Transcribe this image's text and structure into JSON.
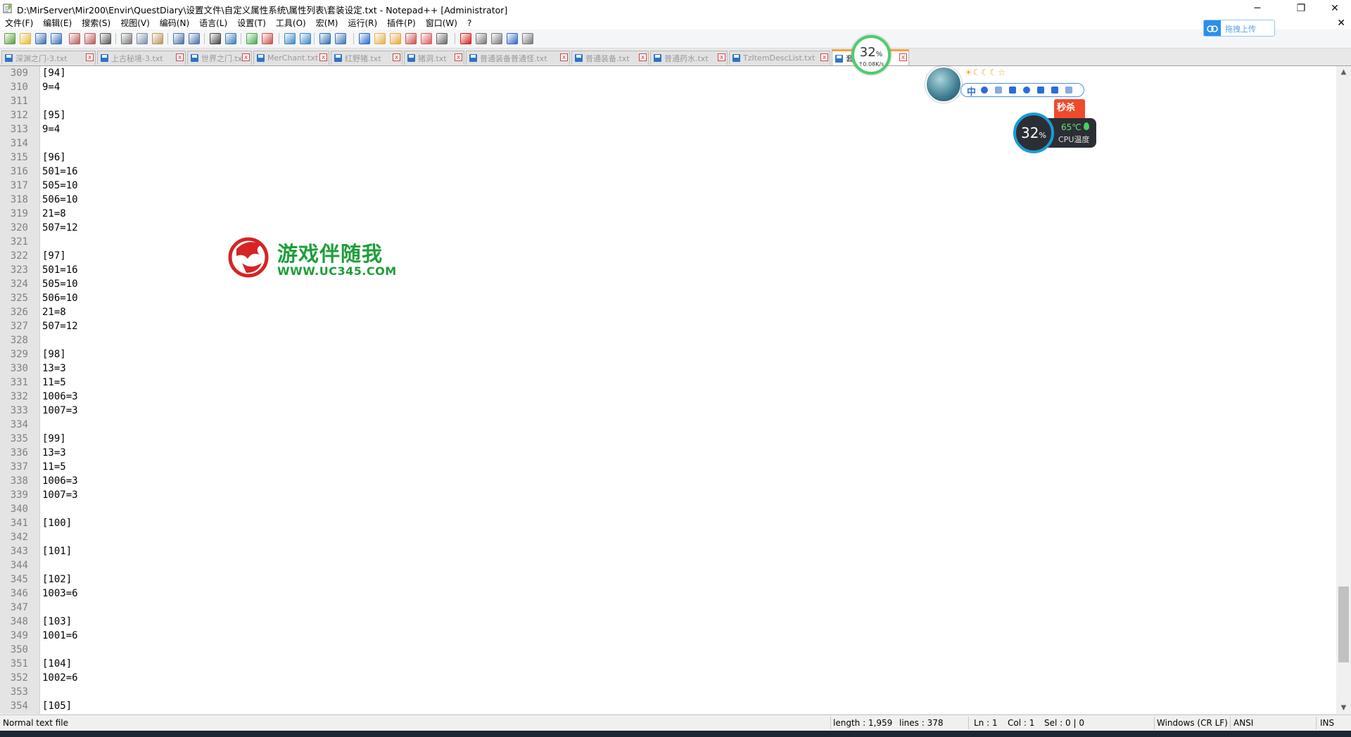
{
  "window": {
    "title": "D:\\MirServer\\Mir200\\Envir\\QuestDiary\\设置文件\\自定义属性系统\\属性列表\\套装设定.txt - Notepad++ [Administrator]",
    "min_glyph": "─",
    "max_glyph": "❐",
    "close_glyph": "✕"
  },
  "menu": [
    {
      "label": "文件(F)"
    },
    {
      "label": "编辑(E)"
    },
    {
      "label": "搜索(S)"
    },
    {
      "label": "视图(V)"
    },
    {
      "label": "编码(N)"
    },
    {
      "label": "语言(L)"
    },
    {
      "label": "设置(T)"
    },
    {
      "label": "工具(O)"
    },
    {
      "label": "宏(M)"
    },
    {
      "label": "运行(R)"
    },
    {
      "label": "插件(P)"
    },
    {
      "label": "窗口(W)"
    },
    {
      "label": "?"
    }
  ],
  "menu_close_glyph": "✕",
  "toolbar": {
    "icons": [
      {
        "name": "new-file-icon",
        "color": "#5a9e3c"
      },
      {
        "name": "open-file-icon",
        "color": "#e8b437"
      },
      {
        "name": "save-icon",
        "color": "#3a6fb7"
      },
      {
        "name": "save-all-icon",
        "color": "#3a6fb7"
      },
      {
        "name": "close-icon",
        "color": "#b95c5c"
      },
      {
        "name": "close-all-icon",
        "color": "#b95c5c"
      },
      {
        "name": "print-icon",
        "color": "#555555"
      },
      {
        "name": "cut-icon",
        "color": "#777777"
      },
      {
        "name": "copy-icon",
        "color": "#7d8fa8"
      },
      {
        "name": "paste-icon",
        "color": "#b9945a"
      },
      {
        "name": "undo-icon",
        "color": "#4b6fa8"
      },
      {
        "name": "redo-icon",
        "color": "#4b6fa8"
      },
      {
        "name": "find-icon",
        "color": "#444444"
      },
      {
        "name": "replace-icon",
        "color": "#3f7ab5"
      },
      {
        "name": "zoom-in-icon",
        "color": "#4ea84e"
      },
      {
        "name": "zoom-out-icon",
        "color": "#c9504c"
      },
      {
        "name": "sync-v-icon",
        "color": "#3d86c9"
      },
      {
        "name": "sync-h-icon",
        "color": "#3d86c9"
      },
      {
        "name": "word-wrap-icon",
        "color": "#2f6db3"
      },
      {
        "name": "show-symbols-icon",
        "color": "#3c73b8"
      },
      {
        "name": "indent-guide-icon",
        "color": "#2a6ad0"
      },
      {
        "name": "udl-icon",
        "color": "#e1b14a"
      },
      {
        "name": "doc-map-icon",
        "color": "#e7a63a"
      },
      {
        "name": "function-list-icon",
        "color": "#cc4f4f"
      },
      {
        "name": "folder-workspace-icon",
        "color": "#d85a5a"
      },
      {
        "name": "monitoring-icon",
        "color": "#666666"
      },
      {
        "name": "macro-record-icon",
        "color": "#d02020"
      },
      {
        "name": "macro-stop-icon",
        "color": "#777777"
      },
      {
        "name": "macro-play-icon",
        "color": "#777777"
      },
      {
        "name": "macro-run-multiple-icon",
        "color": "#3366cc"
      },
      {
        "name": "macro-save-icon",
        "color": "#777777"
      }
    ]
  },
  "tabs": [
    {
      "label": "深渊之门-3.txt",
      "active": false
    },
    {
      "label": "上古秘境-3.txt",
      "active": false
    },
    {
      "label": "世界之门.txt",
      "active": false
    },
    {
      "label": "MerChant.txt",
      "active": false
    },
    {
      "label": "红野猪.txt",
      "active": false
    },
    {
      "label": "猪洞.txt",
      "active": false
    },
    {
      "label": "普通装备普通怪.txt",
      "active": false
    },
    {
      "label": "普通装备.txt",
      "active": false
    },
    {
      "label": "普通药水.txt",
      "active": false
    },
    {
      "label": "TzItemDescList.txt",
      "active": false
    },
    {
      "label": "套装设定.txt",
      "active": true
    }
  ],
  "tab_close_glyph": "x",
  "editor": {
    "lines": [
      {
        "n": "309",
        "t": "[94]"
      },
      {
        "n": "310",
        "t": "9=4"
      },
      {
        "n": "311",
        "t": ""
      },
      {
        "n": "312",
        "t": "[95]"
      },
      {
        "n": "313",
        "t": "9=4"
      },
      {
        "n": "314",
        "t": ""
      },
      {
        "n": "315",
        "t": "[96]"
      },
      {
        "n": "316",
        "t": "501=16"
      },
      {
        "n": "317",
        "t": "505=10"
      },
      {
        "n": "318",
        "t": "506=10"
      },
      {
        "n": "319",
        "t": "21=8"
      },
      {
        "n": "320",
        "t": "507=12"
      },
      {
        "n": "321",
        "t": ""
      },
      {
        "n": "322",
        "t": "[97]"
      },
      {
        "n": "323",
        "t": "501=16"
      },
      {
        "n": "324",
        "t": "505=10"
      },
      {
        "n": "325",
        "t": "506=10"
      },
      {
        "n": "326",
        "t": "21=8"
      },
      {
        "n": "327",
        "t": "507=12"
      },
      {
        "n": "328",
        "t": ""
      },
      {
        "n": "329",
        "t": "[98]"
      },
      {
        "n": "330",
        "t": "13=3"
      },
      {
        "n": "331",
        "t": "11=5"
      },
      {
        "n": "332",
        "t": "1006=3"
      },
      {
        "n": "333",
        "t": "1007=3"
      },
      {
        "n": "334",
        "t": ""
      },
      {
        "n": "335",
        "t": "[99]"
      },
      {
        "n": "336",
        "t": "13=3"
      },
      {
        "n": "337",
        "t": "11=5"
      },
      {
        "n": "338",
        "t": "1006=3"
      },
      {
        "n": "339",
        "t": "1007=3"
      },
      {
        "n": "340",
        "t": ""
      },
      {
        "n": "341",
        "t": "[100]"
      },
      {
        "n": "342",
        "t": ""
      },
      {
        "n": "343",
        "t": "[101]"
      },
      {
        "n": "344",
        "t": ""
      },
      {
        "n": "345",
        "t": "[102]"
      },
      {
        "n": "346",
        "t": "1003=6"
      },
      {
        "n": "347",
        "t": ""
      },
      {
        "n": "348",
        "t": "[103]"
      },
      {
        "n": "349",
        "t": "1001=6"
      },
      {
        "n": "350",
        "t": ""
      },
      {
        "n": "351",
        "t": "[104]"
      },
      {
        "n": "352",
        "t": "1002=6"
      },
      {
        "n": "353",
        "t": ""
      },
      {
        "n": "354",
        "t": "[105]"
      }
    ]
  },
  "watermark": {
    "text": "游戏伴随我",
    "url": "WWW.UC345.COM"
  },
  "scrollbar": {
    "up_glyph": "▲",
    "down_glyph": "▼",
    "position_fraction": 0.86
  },
  "status": {
    "file_type": "Normal text file",
    "length": "length : 1,959",
    "lines": "lines : 378",
    "ln": "Ln : 1",
    "col": "Col : 1",
    "sel": "Sel : 0 | 0",
    "eol": "Windows (CR LF)",
    "encoding": "ANSI",
    "mode": "INS"
  },
  "overlay": {
    "upload_label": "拖拽上传",
    "net_percent": "32",
    "net_speed": "↑0.08K/s",
    "weather_stars": "☀☾☾☾☆",
    "ime_label": "中",
    "sale_label": "秒杀",
    "cpu_percent": "32",
    "cpu_temp": "65℃",
    "cpu_label": "CPU温度",
    "percent_sign": "%"
  }
}
